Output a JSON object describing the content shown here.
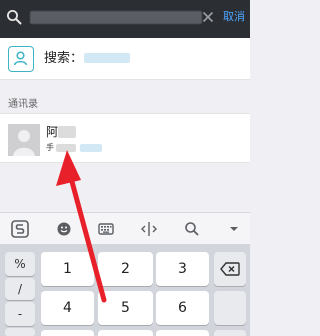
{
  "topbar": {
    "cancel_label": "取消"
  },
  "search_row": {
    "label": "搜索："
  },
  "section": {
    "header": "通讯录"
  },
  "contact": {
    "name": "阿",
    "phone_prefix": "手"
  },
  "keyboard": {
    "toolbar": [
      "sogou-logo",
      "emoji-icon",
      "keyboard-icon",
      "cursor-icon",
      "search-icon",
      "collapse-icon"
    ],
    "side_keys": [
      "%",
      "/",
      "-"
    ],
    "rows": [
      [
        "1",
        "2",
        "3"
      ],
      [
        "4",
        "5",
        "6"
      ]
    ]
  },
  "colors": {
    "topbar_bg": "#2b2e33",
    "accent": "#4ea5ff",
    "arrow": "#e8202a"
  }
}
